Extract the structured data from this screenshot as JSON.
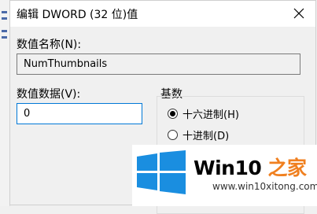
{
  "dialog": {
    "title": "编辑 DWORD (32 位)值",
    "value_name_label": "数值名称(N):",
    "value_name": "NumThumbnails",
    "value_data_label": "数值数据(V):",
    "value_data": "0",
    "base_group_label": "基数",
    "base_options": [
      {
        "label": "十六进制(H)",
        "checked": true
      },
      {
        "label": "十进制(D)",
        "checked": false
      }
    ]
  },
  "watermark": {
    "title_main": "Win10 ",
    "title_accent": "之家",
    "url": "www.win10xitong.com",
    "logo_color": "#1a8ee0"
  }
}
